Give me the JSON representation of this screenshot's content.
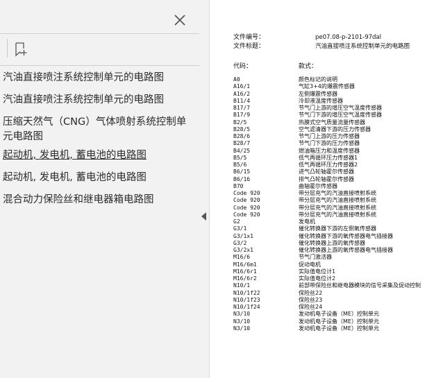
{
  "sidebar": {
    "outline": [
      {
        "label": "汽油直接喷注系统控制单元的电路图",
        "current": false
      },
      {
        "label": "汽油直接喷注系统控制单元的电路图",
        "current": false
      },
      {
        "label": "压缩天然气（CNG）气体喷射系统控制单元电路图",
        "current": false
      },
      {
        "label": "起动机, 发电机, 蓄电池的电路图",
        "current": true
      },
      {
        "label": "起动机, 发电机, 蓄电池的电路图",
        "current": false
      },
      {
        "label": "混合动力保险丝和继电器箱电路图",
        "current": false
      }
    ]
  },
  "document": {
    "file_number_label": "文件编号：",
    "file_number_value": "pe07.08-p-2101-97dal",
    "file_title_label": "文件标题：",
    "file_title_value": "汽油直接喷注系统控制单元的电路图",
    "code_header": "代码：",
    "desc_header": "款式：",
    "rows": [
      {
        "code": "A0",
        "desc": "颜色标记的说明"
      },
      {
        "code": "A16/1",
        "desc": "气缸3+4的爆震传感器"
      },
      {
        "code": "A16/2",
        "desc": "左侧爆震传感器"
      },
      {
        "code": "B11/4",
        "desc": "冷却液温度传感器"
      },
      {
        "code": "B17/7",
        "desc": "节气门上游的增压空气温度传感器"
      },
      {
        "code": "B17/9",
        "desc": "节气门下游的增压空气温度传感器"
      },
      {
        "code": "B2/5",
        "desc": "热膜式空气质量流量传感器"
      },
      {
        "code": "B28/5",
        "desc": "空气滤清器下游的压力传感器"
      },
      {
        "code": "B28/6",
        "desc": "节气门上游的压力传感器"
      },
      {
        "code": "B28/7",
        "desc": "节气门下游的压力传感器"
      },
      {
        "code": "B4/25",
        "desc": "燃油箱压力和温度传感器"
      },
      {
        "code": "B5/5",
        "desc": "低气再循环压力传感器1"
      },
      {
        "code": "B5/6",
        "desc": "低气再循环压力传感器2"
      },
      {
        "code": "B6/15",
        "desc": "进气凸轮轴霍尔传感器"
      },
      {
        "code": "B6/16",
        "desc": "排气凸轮轴霍尔传感器"
      },
      {
        "code": "B70",
        "desc": "曲轴霍尔传感器"
      },
      {
        "code": "Code 920",
        "desc": "带分层充气的汽油直接喷射系统"
      },
      {
        "code": "Code 920",
        "desc": "带分层充气的汽油直接喷射系统"
      },
      {
        "code": "Code 920",
        "desc": "带分层充气的汽油直接喷射系统"
      },
      {
        "code": "Code 920",
        "desc": "带分层充气的汽油直接喷射系统"
      },
      {
        "code": "G2",
        "desc": "发电机"
      },
      {
        "code": "G3/1",
        "desc": "催化转换器下游的左侧氧传感器"
      },
      {
        "code": "G3/1x1",
        "desc": "催化转换器下游的氧传感器电气插接器"
      },
      {
        "code": "G3/2",
        "desc": "催化转换器上游的氧传感器"
      },
      {
        "code": "G3/2x1",
        "desc": "催化转换器上游的氧传感器电气插接器"
      },
      {
        "code": "M16/6",
        "desc": "节气门激活器"
      },
      {
        "code": "M16/6m1",
        "desc": "促动电机"
      },
      {
        "code": "M16/6r1",
        "desc": "实际值电位计1"
      },
      {
        "code": "M16/6r2",
        "desc": "实际值电位计2"
      },
      {
        "code": "N10/1",
        "desc": "前部带保险丝和继电器模块的信号采集及促动控制"
      },
      {
        "code": "N10/1f22",
        "desc": "保险丝22"
      },
      {
        "code": "N10/1f23",
        "desc": "保险丝23"
      },
      {
        "code": "N10/1f24",
        "desc": "保险丝24"
      },
      {
        "code": "N3/10",
        "desc": "发动机电子设备（ME）控制单元"
      },
      {
        "code": "N3/10",
        "desc": "发动机电子设备（ME）控制单元"
      },
      {
        "code": "N3/10",
        "desc": "发动机电子设备（ME）控制单元"
      }
    ]
  }
}
